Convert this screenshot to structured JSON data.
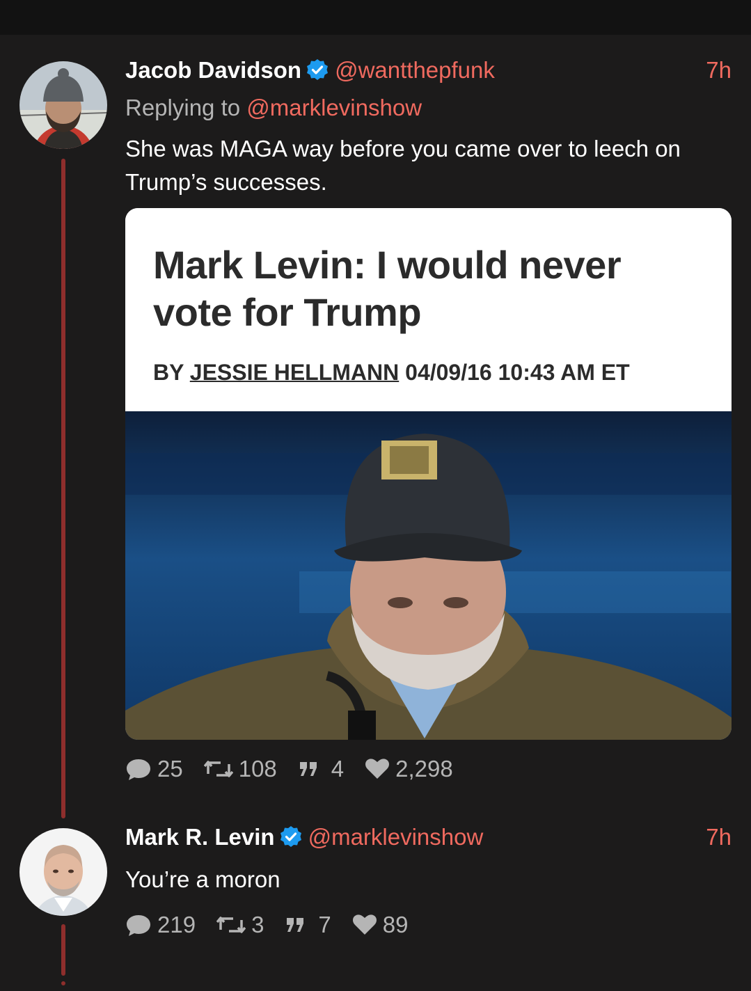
{
  "tweets": [
    {
      "name": "Jacob Davidson",
      "handle": "@wantthepfunk",
      "time": "7h",
      "replying_prefix": "Replying to",
      "replying_handle": "@marklevinshow",
      "text": "She was MAGA way before you came over to leech on Trump’s successes.",
      "card": {
        "headline": "Mark Levin: I would never vote for Trump",
        "byline_prefix": "BY",
        "byline_author": "JESSIE HELLMANN",
        "byline_date": "04/09/16 10:43 AM ET"
      },
      "stats": {
        "replies": "25",
        "retweets": "108",
        "quotes": "4",
        "likes": "2,298"
      }
    },
    {
      "name": "Mark R. Levin",
      "handle": "@marklevinshow",
      "time": "7h",
      "text": "You’re a moron",
      "stats": {
        "replies": "219",
        "retweets": "3",
        "quotes": "7",
        "likes": "89"
      }
    }
  ],
  "colors": {
    "accent": "#f06a5f",
    "thread": "#8e2e2c",
    "verified": "#1d9bf0",
    "background": "#1c1b1b"
  },
  "icons": [
    "verified-badge-icon",
    "reply-icon",
    "retweet-icon",
    "quote-icon",
    "like-icon"
  ]
}
